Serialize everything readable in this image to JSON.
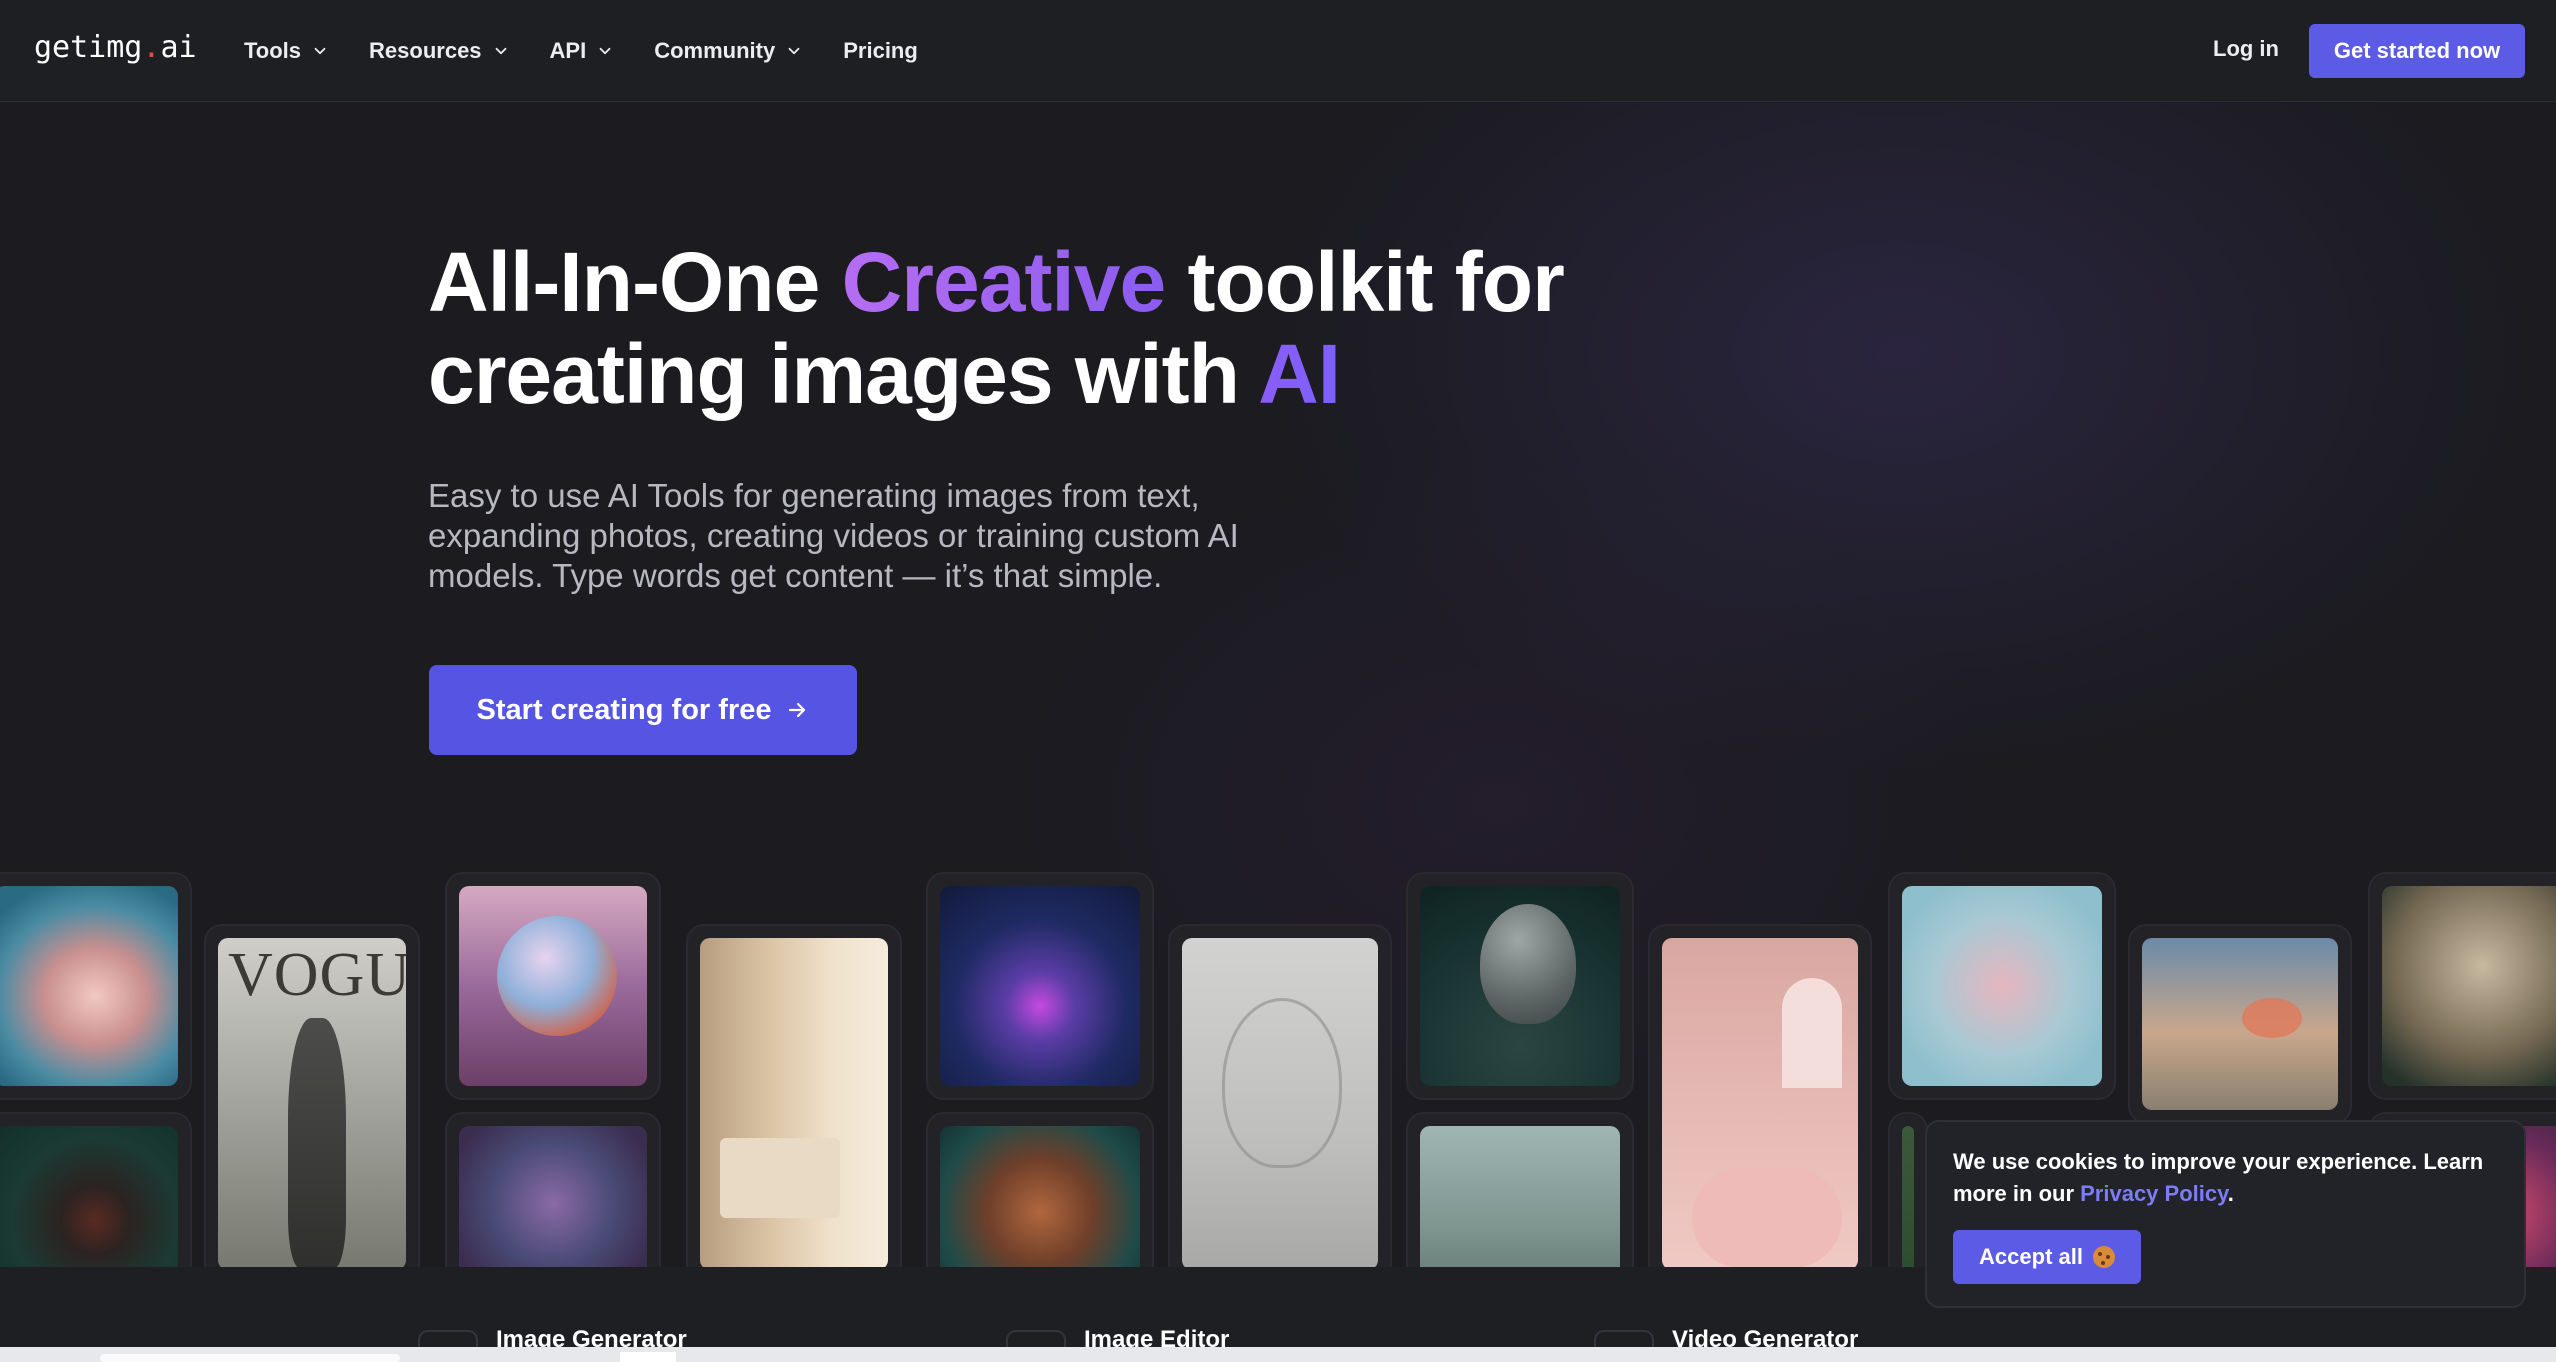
{
  "nav": {
    "logo_main": "getimg",
    "logo_dot": ".",
    "logo_tld": "ai",
    "links": [
      {
        "label": "Tools",
        "dropdown": true
      },
      {
        "label": "Resources",
        "dropdown": true
      },
      {
        "label": "API",
        "dropdown": true
      },
      {
        "label": "Community",
        "dropdown": true
      },
      {
        "label": "Pricing",
        "dropdown": false
      }
    ],
    "login_label": "Log in",
    "cta_label": "Get started now"
  },
  "hero": {
    "headline_part1": "All-In-One ",
    "headline_highlight1": "Creative",
    "headline_part2": " toolkit for",
    "headline_part3": "creating images with ",
    "headline_highlight2": "AI",
    "subtitle": "Easy to use AI Tools for generating images from text, expanding photos, creating videos or training custom AI models. Type words get content — it’s that simple.",
    "cta_label": "Start creating for free"
  },
  "features": [
    {
      "label": "Image Generator",
      "icon": "image-grid-icon"
    },
    {
      "label": "Image Editor",
      "icon": "file-edit-icon"
    },
    {
      "label": "Video Generator",
      "icon": "video-icon"
    }
  ],
  "cookie": {
    "text_before": "We use cookies to improve your experience. Learn more in our ",
    "link_label": "Privacy Policy",
    "text_after": ".",
    "accept_label": "Accept all",
    "accept_icon": "cookie-icon"
  },
  "colors": {
    "accent": "#5b5be6",
    "background": "#1b1b20",
    "logo_dot": "#e5484d",
    "headline_gradient": "#b66df2"
  }
}
